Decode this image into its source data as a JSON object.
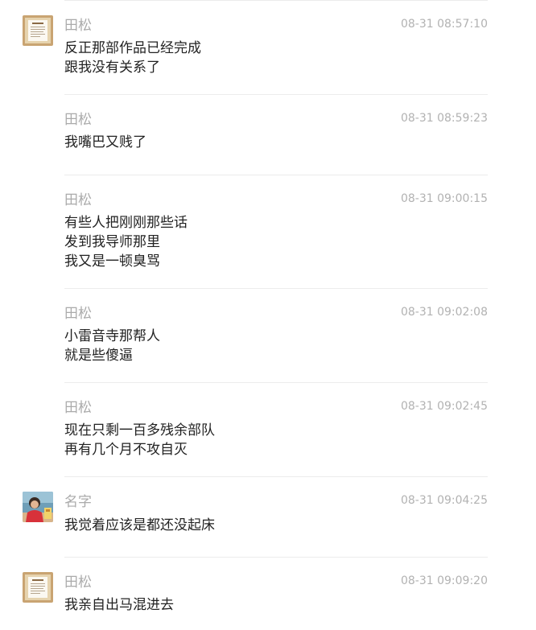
{
  "messages": [
    {
      "sender": "田松",
      "time": "08-31 08:57:10",
      "avatar": "certificate-frame-avatar",
      "lines": [
        "反正那部作品已经完成",
        "跟我没有关系了"
      ]
    },
    {
      "sender": "田松",
      "time": "08-31 08:59:23",
      "lines": [
        "我嘴巴又贱了"
      ]
    },
    {
      "sender": "田松",
      "time": "08-31 09:00:15",
      "lines": [
        "有些人把刚刚那些话",
        "发到我导师那里",
        "我又是一顿臭骂"
      ]
    },
    {
      "sender": "田松",
      "time": "08-31 09:02:08",
      "lines": [
        "小雷音寺那帮人",
        "就是些傻逼"
      ]
    },
    {
      "sender": "田松",
      "time": "08-31 09:02:45",
      "lines": [
        "现在只剩一百多残余部队",
        "再有几个月不攻自灭"
      ]
    },
    {
      "sender": "名字",
      "time": "08-31 09:04:25",
      "avatar": "person-photo-avatar",
      "lines": [
        "我觉着应该是都还没起床"
      ]
    },
    {
      "sender": "田松",
      "time": "08-31 09:09:20",
      "avatar": "certificate-frame-avatar",
      "lines": [
        "我亲自出马混进去"
      ]
    }
  ]
}
